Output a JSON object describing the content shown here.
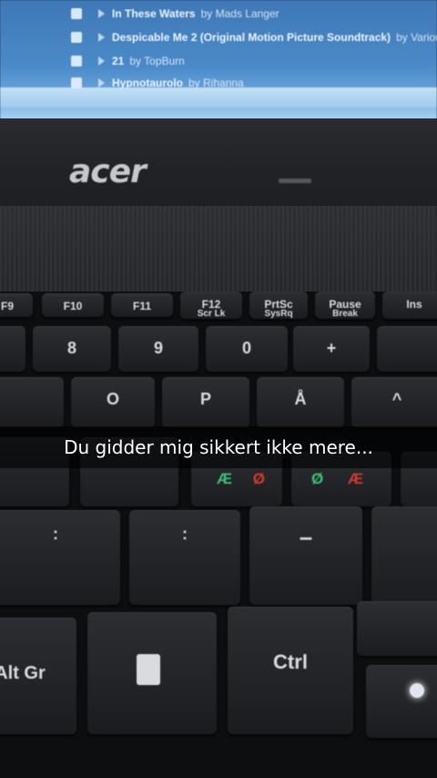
{
  "screen": {
    "rows": [
      {
        "track": "In These Waters",
        "artist": "by Mads Langer"
      },
      {
        "track": "Despicable Me 2 (Original Motion Picture Soundtrack)",
        "artist": "by Various A"
      },
      {
        "track": "21",
        "artist": "by TopBurn"
      },
      {
        "track": "Hypnotaurolo",
        "artist": "by Rihanna"
      }
    ]
  },
  "laptop": {
    "brand": "acer"
  },
  "keys": {
    "f9": "F9",
    "f10": "F10",
    "f11": "F11",
    "f12": "F12",
    "f12_sub": "Scr Lk",
    "prtsc": "PrtSc",
    "prtsc_sub": "SysRq",
    "pause": "Pause",
    "pause_sub": "Break",
    "ins": "Ins",
    "n8": "8",
    "n9": "9",
    "n0": "0",
    "plus": "+",
    "o": "O",
    "p": "P",
    "aring": "Å",
    "umlaut": "^",
    "ae": "Æ",
    "oslash": "Ø",
    "period": ":",
    "minus": "–",
    "altgr": "Alt Gr",
    "ctrl": "Ctrl"
  },
  "caption": {
    "text": "Du gidder mig sikkert ikke mere..."
  }
}
